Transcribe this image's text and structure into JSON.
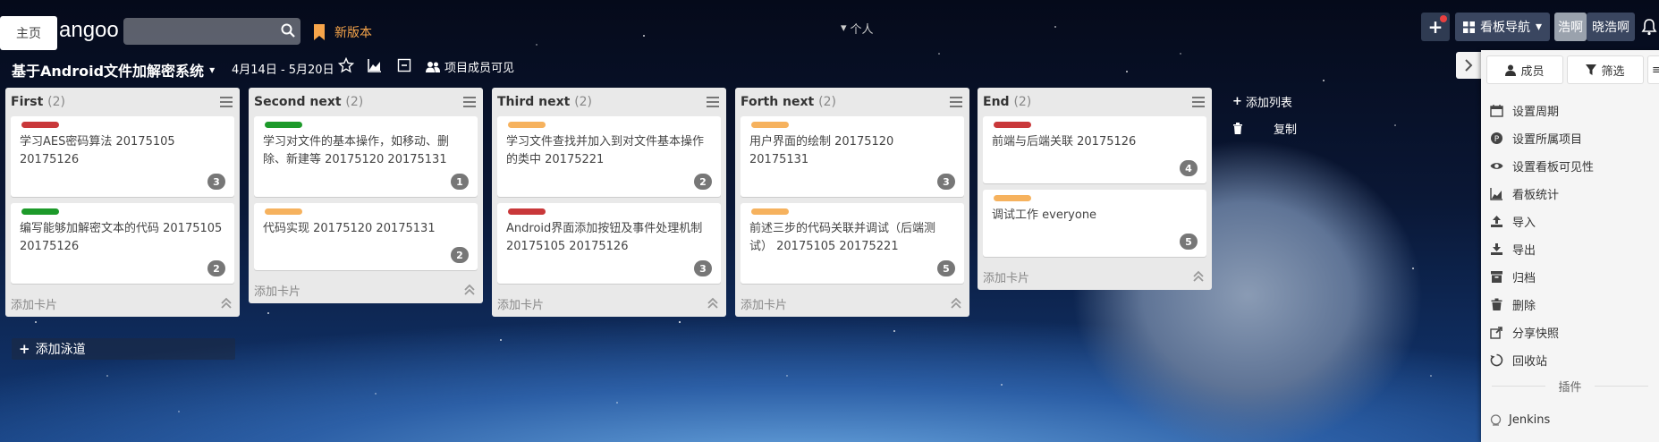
{
  "header": {
    "home_label": "主页",
    "logo_text": "angoo",
    "search_placeholder": "",
    "new_version": "新版本",
    "personal": "个人",
    "board_nav": "看板导航",
    "user_short": "浩啊",
    "user_name": "晓浩啊"
  },
  "board": {
    "title": "基于Android文件加解密系统",
    "date_range": "4月14日 - 5月20日",
    "visibility": "项目成员可见"
  },
  "colors": {
    "red": "#c9383a",
    "green": "#1d9a2a",
    "orange": "#f6b25e",
    "accent": "#f7a54a"
  },
  "lists": [
    {
      "title": "First",
      "count": "(2)",
      "add_card": "添加卡片",
      "cards": [
        {
          "label_color": "red",
          "text": "学习AES密码算法  20175105  20175126",
          "badge": "3"
        },
        {
          "label_color": "green",
          "text": "编写能够加解密文本的代码  20175105  20175126",
          "badge": "2"
        }
      ]
    },
    {
      "title": "Second next",
      "count": "(2)",
      "add_card": "添加卡片",
      "cards": [
        {
          "label_color": "green",
          "text": "学习对文件的基本操作，如移动、删除、新建等  20175120  20175131",
          "badge": "1"
        },
        {
          "label_color": "orange",
          "text": "代码实现 20175120  20175131",
          "badge": "2"
        }
      ]
    },
    {
      "title": "Third next",
      "count": "(2)",
      "add_card": "添加卡片",
      "cards": [
        {
          "label_color": "orange",
          "text": "学习文件查找并加入到对文件基本操作的类中  20175221",
          "badge": "2"
        },
        {
          "label_color": "red",
          "text": "Android界面添加按钮及事件处理机制  20175105  20175126",
          "badge": "3"
        }
      ]
    },
    {
      "title": "Forth next",
      "count": "(2)",
      "add_card": "添加卡片",
      "cards": [
        {
          "label_color": "orange",
          "text": "用户界面的绘制  20175120  20175131",
          "badge": "3"
        },
        {
          "label_color": "orange",
          "text": "前述三步的代码关联并调试（后端测试）   20175105 20175221",
          "badge": "5"
        }
      ]
    },
    {
      "title": "End",
      "count": "(2)",
      "add_card": "添加卡片",
      "cards": [
        {
          "label_color": "red",
          "text": "前端与后端关联  20175126",
          "badge": "4"
        },
        {
          "label_color": "orange",
          "text": "调试工作  everyone",
          "badge": "5"
        }
      ]
    }
  ],
  "add_lane": "添加泳道",
  "add_list": "添加列表",
  "copy": "复制",
  "panel": {
    "tab_members": "成员",
    "tab_filter": "筛选",
    "menu": [
      {
        "icon": "calendar-icon",
        "label": "设置周期"
      },
      {
        "icon": "project-icon",
        "label": "设置所属项目"
      },
      {
        "icon": "eye-icon",
        "label": "设置看板可见性"
      },
      {
        "icon": "chart-icon",
        "label": "看板统计"
      },
      {
        "icon": "upload-icon",
        "label": "导入"
      },
      {
        "icon": "download-icon",
        "label": "导出"
      },
      {
        "icon": "archive-icon",
        "label": "归档"
      },
      {
        "icon": "trash-icon",
        "label": "删除"
      },
      {
        "icon": "share-icon",
        "label": "分享快照"
      },
      {
        "icon": "recycle-icon",
        "label": "回收站"
      }
    ],
    "plugins_heading": "插件",
    "jenkins": "Jenkins"
  }
}
